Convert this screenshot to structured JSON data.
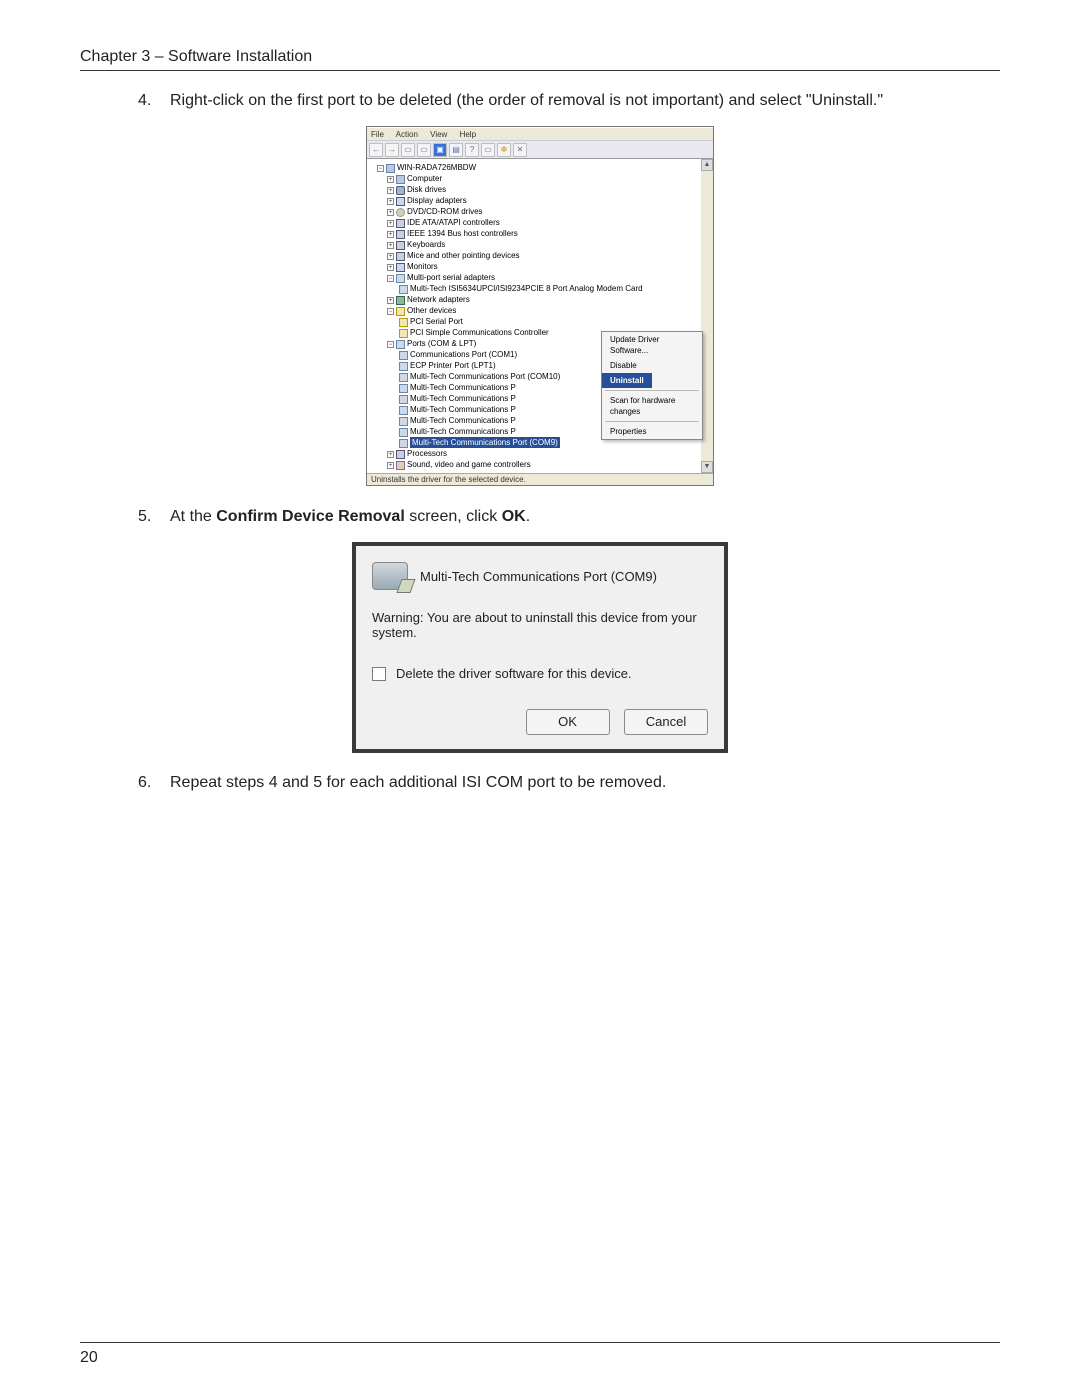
{
  "chapter_heading": "Chapter 3 – Software Installation",
  "page_number": "20",
  "steps": {
    "s4": {
      "num": "4.",
      "text": "Right-click on the first port to be deleted (the order of removal is not important) and select \"Uninstall.\""
    },
    "s5": {
      "num": "5.",
      "prefix": "At the ",
      "bold1": "Confirm Device Removal",
      "mid": " screen, click ",
      "bold2": "OK",
      "suffix": "."
    },
    "s6": {
      "num": "6.",
      "text": "Repeat steps 4 and 5 for each additional ISI COM port to be removed."
    }
  },
  "devmgr": {
    "menu": {
      "file": "File",
      "action": "Action",
      "view": "View",
      "help": "Help"
    },
    "toolbar_icons": {
      "back": "←",
      "fwd": "→",
      "org": "▭",
      "props": "▭",
      "monitor": "▣",
      "refresh": "▤",
      "help": "?",
      "prop": "▭",
      "scan": "✲",
      "uninstall": "✕"
    },
    "root": "WIN-RADA726MBDW",
    "nodes": {
      "computer": "Computer",
      "disk": "Disk drives",
      "display": "Display adapters",
      "dvd": "DVD/CD-ROM drives",
      "ide": "IDE ATA/ATAPI controllers",
      "ieee": "IEEE 1394 Bus host controllers",
      "kb": "Keyboards",
      "mice": "Mice and other pointing devices",
      "monitors": "Monitors",
      "multiport": "Multi-port serial adapters",
      "multiport_child": "Multi-Tech ISI5634UPCI/ISI9234PCIE 8 Port Analog Modem Card",
      "net": "Network adapters",
      "other": "Other devices",
      "pci_serial": "PCI Serial Port",
      "pci_simple": "PCI Simple Communications Controller",
      "ports": "Ports (COM & LPT)",
      "com1": "Communications Port (COM1)",
      "lpt1": "ECP Printer Port (LPT1)",
      "mt_com10": "Multi-Tech Communications Port (COM10)",
      "mt_p_a": "Multi-Tech Communications P",
      "mt_p_b": "Multi-Tech Communications P",
      "mt_p_c": "Multi-Tech Communications P",
      "mt_p_d": "Multi-Tech Communications P",
      "mt_p_e": "Multi-Tech Communications P",
      "mt_sel": "Multi-Tech Communications Port (COM9)",
      "proc": "Processors",
      "sound": "Sound, video and game controllers"
    },
    "context_menu": {
      "update": "Update Driver Software...",
      "disable": "Disable",
      "uninstall": "Uninstall",
      "scan": "Scan for hardware changes",
      "properties": "Properties"
    },
    "status_bar": "Uninstalls the driver for the selected device."
  },
  "dialog": {
    "device_name": "Multi-Tech Communications Port (COM9)",
    "warning": "Warning: You are about to uninstall this device from your system.",
    "checkbox_label": "Delete the driver software for this device.",
    "ok": "OK",
    "cancel": "Cancel"
  }
}
